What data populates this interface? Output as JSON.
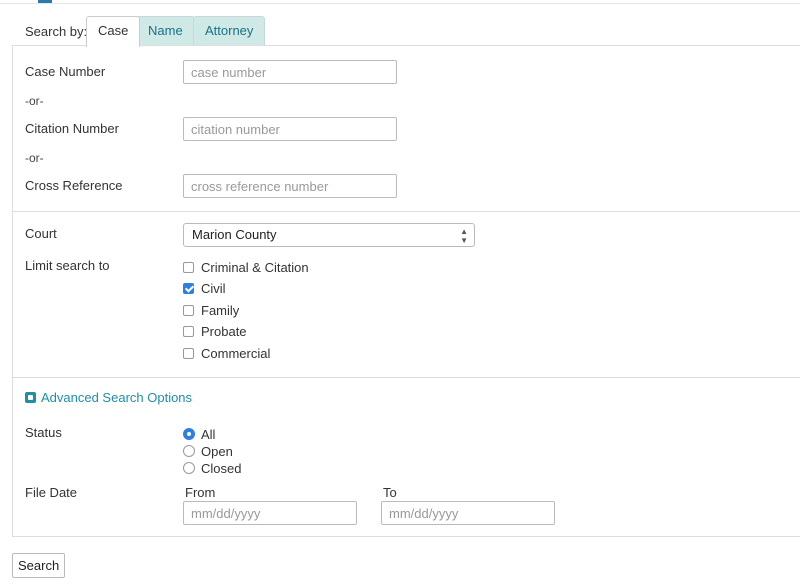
{
  "tabs": {
    "lead_label": "Search by:",
    "items": [
      {
        "label": "Case",
        "active": true
      },
      {
        "label": "Name",
        "active": false
      },
      {
        "label": "Attorney",
        "active": false
      }
    ]
  },
  "case_section": {
    "case_number": {
      "label": "Case Number",
      "placeholder": "case number",
      "value": ""
    },
    "or_1": "-or-",
    "citation_number": {
      "label": "Citation Number",
      "placeholder": "citation number",
      "value": ""
    },
    "or_2": "-or-",
    "cross_reference": {
      "label": "Cross Reference",
      "placeholder": "cross reference number",
      "value": ""
    }
  },
  "court_section": {
    "court_label": "Court",
    "court_selected": "Marion County",
    "limit_label": "Limit search to",
    "limit_options": [
      {
        "label": "Criminal & Citation",
        "checked": false
      },
      {
        "label": "Civil",
        "checked": true
      },
      {
        "label": "Family",
        "checked": false
      },
      {
        "label": "Probate",
        "checked": false
      },
      {
        "label": "Commercial",
        "checked": false
      }
    ]
  },
  "advanced": {
    "toggle_label": "Advanced Search Options",
    "status_label": "Status",
    "status_options": [
      {
        "label": "All",
        "selected": true
      },
      {
        "label": "Open",
        "selected": false
      },
      {
        "label": "Closed",
        "selected": false
      }
    ],
    "file_date_label": "File Date",
    "from_label": "From",
    "from_placeholder": "mm/dd/yyyy",
    "to_label": "To",
    "to_placeholder": "mm/dd/yyyy"
  },
  "search_button_label": "Search",
  "colors": {
    "tab_inactive_bg": "#cfeae6",
    "tab_inactive_text": "#1b6f86",
    "link_accent": "#1f8fa8",
    "checked_blue": "#2f7fe2"
  }
}
